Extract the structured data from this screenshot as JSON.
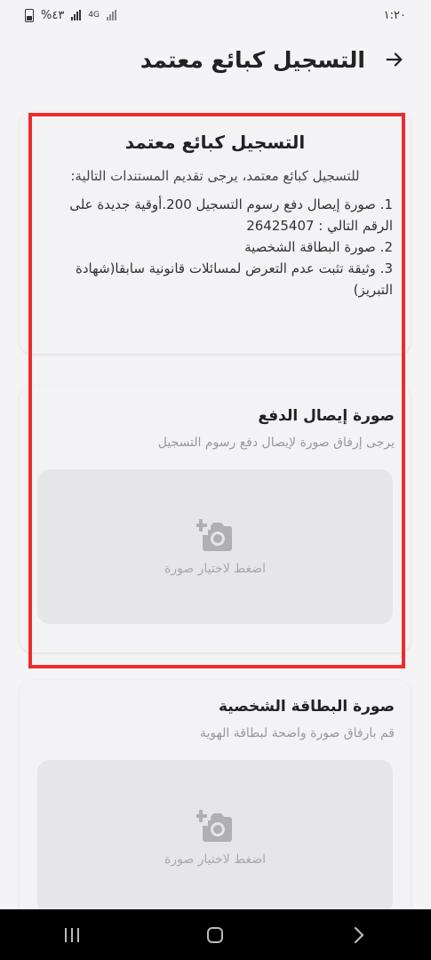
{
  "status_bar": {
    "time": "١:٢٠",
    "battery": "%٤٣",
    "network": "4G"
  },
  "header": {
    "title": "التسجيل كبائع معتمد"
  },
  "info_card": {
    "title": "التسجيل كبائع معتمد",
    "intro": "للتسجيل كبائع معتمد، يرجى تقديم المستندات التالية:",
    "requirements": [
      "1. صورة إيصال دفع رسوم التسجيل 200.أوقية جديدة على الرقم التالي : 26425407",
      "2. صورة البطاقة الشخصية",
      "3. وثيقة تثبت عدم التعرض لمسائلات قانونية سابقا(شهادة التبريز)"
    ]
  },
  "payment_section": {
    "title": "صورة إيصال الدفع",
    "description": "يرجى إرفاق صورة لإيصال دفع رسوم التسجيل",
    "upload_label": "اضغط لاختيار صورة",
    "icon": "add-photo-icon"
  },
  "id_section": {
    "title": "صورة البطاقة الشخصية",
    "description": "قم بارفاق صورة واضحة لبطاقة الهوية",
    "upload_label": "اضغط لاختيار صورة",
    "icon": "add-photo-icon"
  },
  "colors": {
    "highlight": "#ef2b2d",
    "background": "#f4f4f6",
    "upload_box": "#e6e6e8",
    "icon_gray": "#b0b0b3"
  }
}
